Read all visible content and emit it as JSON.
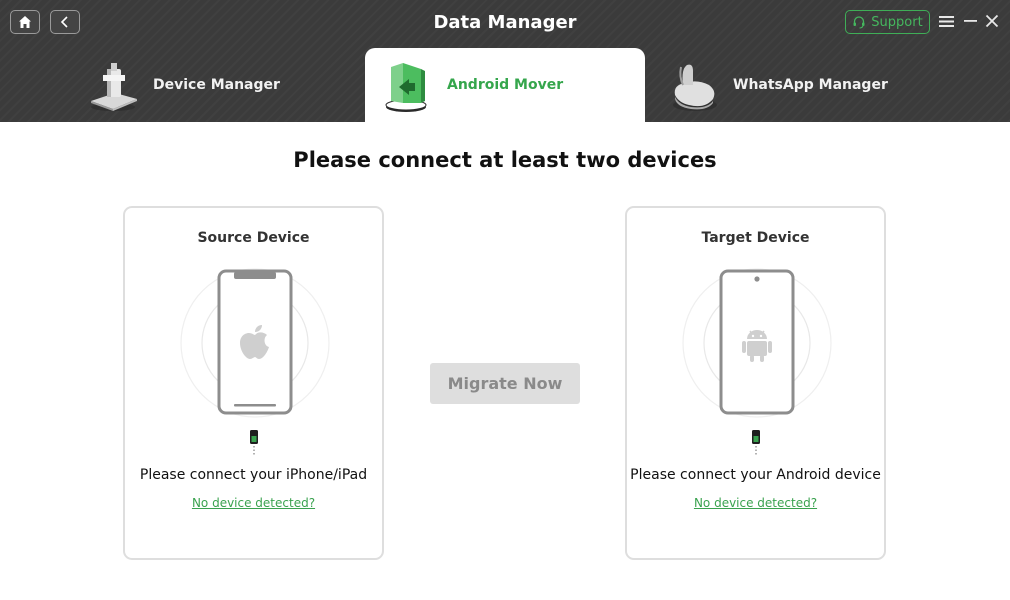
{
  "app": {
    "title": "Data Manager"
  },
  "header": {
    "support_label": "Support",
    "tabs": [
      {
        "label": "Device Manager",
        "icon": "device-manager-icon",
        "active": false
      },
      {
        "label": "Android Mover",
        "icon": "android-mover-icon",
        "active": true
      },
      {
        "label": "WhatsApp Manager",
        "icon": "whatsapp-manager-icon",
        "active": false
      }
    ]
  },
  "main": {
    "title": "Please connect at least two devices",
    "source": {
      "title": "Source Device",
      "prompt": "Please connect your iPhone/iPad",
      "link": "No device detected?",
      "icon": "apple-icon"
    },
    "target": {
      "title": "Target Device",
      "prompt": "Please connect your Android device",
      "link": "No device detected?",
      "icon": "android-icon"
    },
    "migrate_label": "Migrate Now"
  },
  "colors": {
    "header_bg": "#3b3b3b",
    "accent_green": "#3aa24f",
    "disabled_button_bg": "#dedede",
    "disabled_button_text": "#8a8a8a",
    "card_border": "#dedede"
  }
}
